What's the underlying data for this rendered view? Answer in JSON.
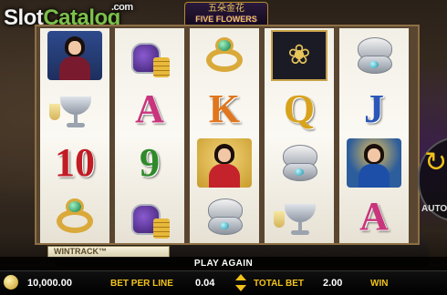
{
  "watermark": {
    "slot": "Slot",
    "catalog": "Catalog",
    "com": ".com"
  },
  "game_title": {
    "chinese": "五朵金花",
    "english": "FIVE FLOWERS"
  },
  "reels": [
    [
      "lady-purple-icon",
      "ice-bucket-champagne-icon",
      "10",
      "emerald-ring-icon"
    ],
    [
      "jeweled-purse-coins-icon",
      "A",
      "9",
      "jeweled-purse-coins-icon"
    ],
    [
      "emerald-ring-icon",
      "K",
      "lady-red-icon",
      "diamond-compact-icon"
    ],
    [
      "gold-flower-icon",
      "Q",
      "diamond-compact-icon",
      "ice-bucket-champagne-icon"
    ],
    [
      "diamond-compact-icon",
      "J",
      "lady-deco-icon",
      "A"
    ]
  ],
  "card_colors": {
    "10": "#c21b24",
    "9": "#2f8a2a",
    "A": "#c8357d",
    "K": "#e0761d",
    "Q": "#d9a21c",
    "J": "#2b57b8"
  },
  "wintrack_label": "WINTRACK™",
  "message": "PLAY AGAIN",
  "autospin_label": "AUTOS",
  "bottom_bar": {
    "balance_value": "10,000.00",
    "bet_per_line_label": "BET PER LINE",
    "bet_per_line_value": "0.04",
    "total_bet_label": "TOTAL BET",
    "total_bet_value": "2.00",
    "win_label": "WIN"
  }
}
